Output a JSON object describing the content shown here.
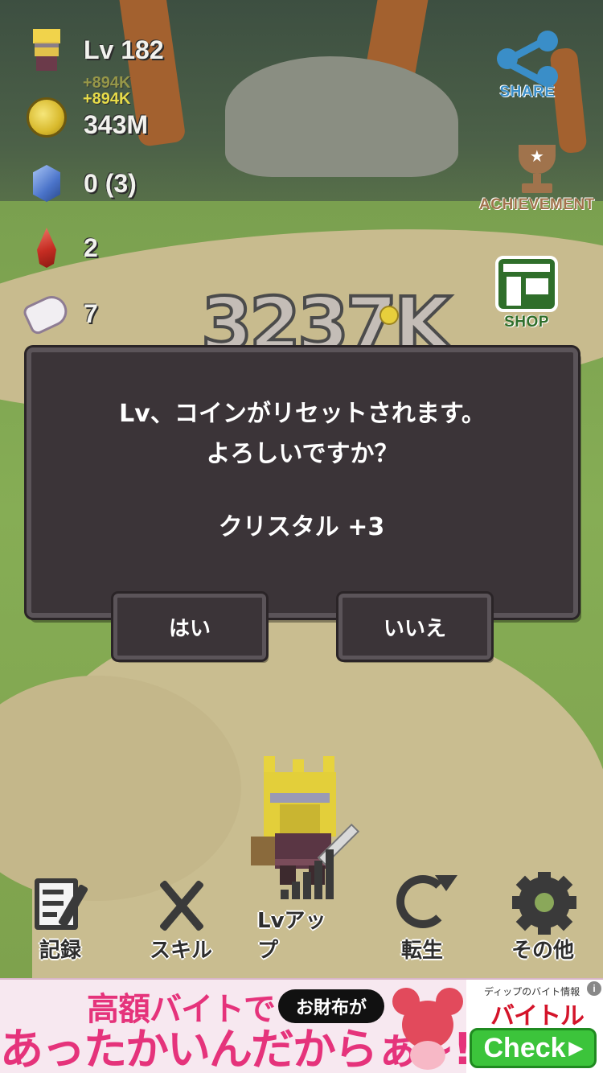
{
  "status": {
    "level": "Lv 182",
    "coin_gain_1": "+894K",
    "coin_gain_2": "+894K",
    "coins": "343M",
    "crystals": "0 (3)",
    "rubies": "2",
    "taps": "7"
  },
  "damage_popup": "3237K",
  "side_buttons": {
    "share": "SHARE",
    "achievement": "ACHIEVEMENT",
    "shop": "SHOP"
  },
  "dialog": {
    "line1": "Lv、コインがリセットされます。",
    "line2": "よろしいですか？",
    "reward": "クリスタル +3",
    "yes": "はい",
    "no": "いいえ"
  },
  "bottom_menu": [
    {
      "label": "記録",
      "icon": "record-icon"
    },
    {
      "label": "スキル",
      "icon": "crossed-swords-icon"
    },
    {
      "label": "Lvアップ",
      "icon": "level-up-bars-icon"
    },
    {
      "label": "転生",
      "icon": "rebirth-icon"
    },
    {
      "label": "その他",
      "icon": "gear-icon"
    }
  ],
  "ad": {
    "headline": "高額バイトで",
    "pill": "お財布が",
    "tagline": "あったかいんだからぁ~!",
    "small": "ディップのバイト情報",
    "brand": "バイトル",
    "cta": "Check",
    "info": "i"
  },
  "colors": {
    "dialog_bg": "#3b3438",
    "dialog_border": "#5b5459",
    "share_blue": "#3a8ec8",
    "trophy_brown": "#a0734c",
    "shop_green": "#2f6e2a",
    "ad_pink": "#e5337b",
    "ad_cta_green": "#3cc43b"
  }
}
